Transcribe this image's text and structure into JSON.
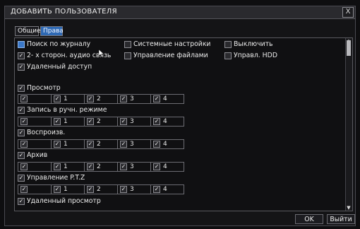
{
  "window": {
    "title": "ДОБАВИТЬ ПОЛЬЗОВАТЕЛЯ",
    "close_label": "X"
  },
  "tabs": [
    {
      "label": "Общие"
    },
    {
      "label": "Права"
    }
  ],
  "top_options": [
    {
      "label": "Поиск по журналу",
      "checked": false,
      "selected": true
    },
    {
      "label": "Системные настройки",
      "checked": false
    },
    {
      "label": "Выключить",
      "checked": false
    },
    {
      "label": "2- х сторон. аудио связь",
      "checked": true
    },
    {
      "label": "Управление файлами",
      "checked": false
    },
    {
      "label": "Управл. HDD",
      "checked": false
    },
    {
      "label": "Удаленный доступ",
      "checked": true
    }
  ],
  "channel_sections": [
    {
      "label": "Просмотр",
      "checked": true,
      "channels": [
        "",
        "1",
        "2",
        "3",
        "4"
      ]
    },
    {
      "label": "Запись в ручн. режиме",
      "checked": true,
      "channels": [
        "",
        "1",
        "2",
        "3",
        "4"
      ]
    },
    {
      "label": "Воспроизв.",
      "checked": true,
      "channels": [
        "",
        "1",
        "2",
        "3",
        "4"
      ]
    },
    {
      "label": "Архив",
      "checked": true,
      "channels": [
        "",
        "1",
        "2",
        "3",
        "4"
      ]
    },
    {
      "label": "Управление P.T.Z",
      "checked": true,
      "channels": [
        "",
        "1",
        "2",
        "3",
        "4"
      ]
    }
  ],
  "bottom_option": {
    "label": "Удаленный просмотр",
    "checked": true
  },
  "buttons": {
    "ok": "OK",
    "exit": "Выйти"
  },
  "icons": {
    "checkbox": "checkbox-icon",
    "close": "close-icon",
    "cursor": "mouse-pointer-icon"
  }
}
